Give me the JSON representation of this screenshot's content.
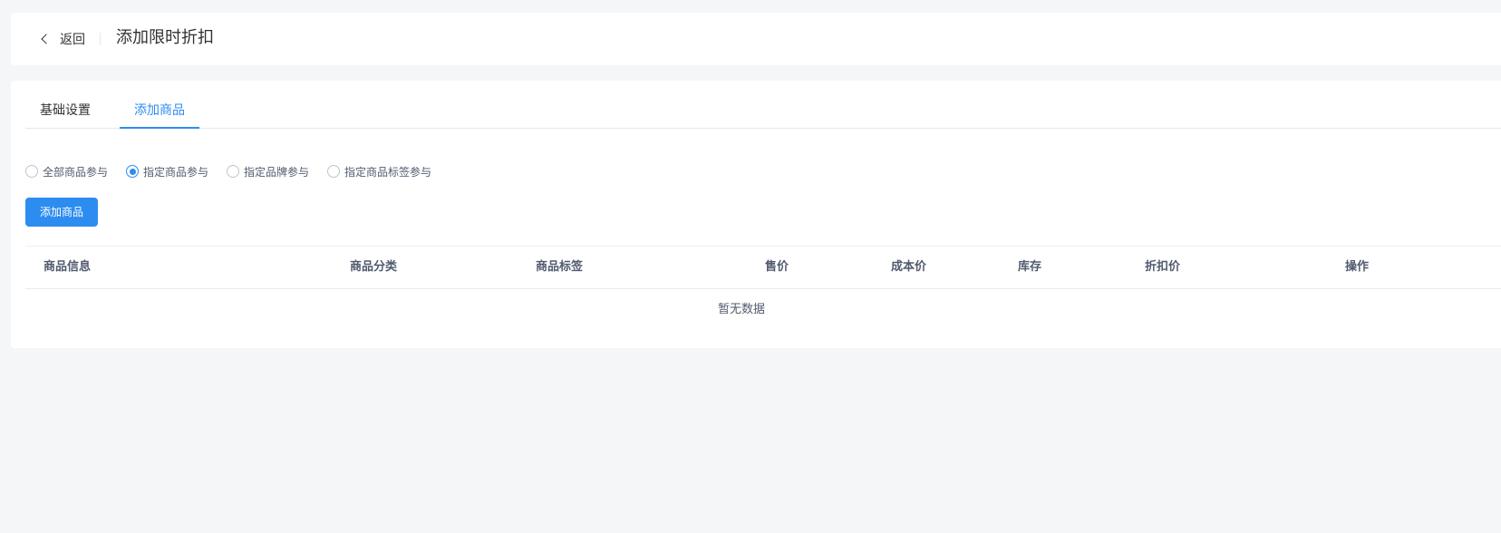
{
  "header": {
    "back_label": "返回",
    "title": "添加限时折扣"
  },
  "tabs": [
    {
      "label": "基础设置",
      "active": false
    },
    {
      "label": "添加商品",
      "active": true
    }
  ],
  "radio_options": [
    {
      "label": "全部商品参与",
      "checked": false
    },
    {
      "label": "指定商品参与",
      "checked": true
    },
    {
      "label": "指定品牌参与",
      "checked": false
    },
    {
      "label": "指定商品标签参与",
      "checked": false
    }
  ],
  "add_button_label": "添加商品",
  "table": {
    "columns": [
      "商品信息",
      "商品分类",
      "商品标签",
      "售价",
      "成本价",
      "库存",
      "折扣价",
      "操作"
    ],
    "empty_text": "暂无数据"
  },
  "colors": {
    "accent": "#2d8cf0",
    "background": "#f5f6f8",
    "card": "#ffffff"
  }
}
